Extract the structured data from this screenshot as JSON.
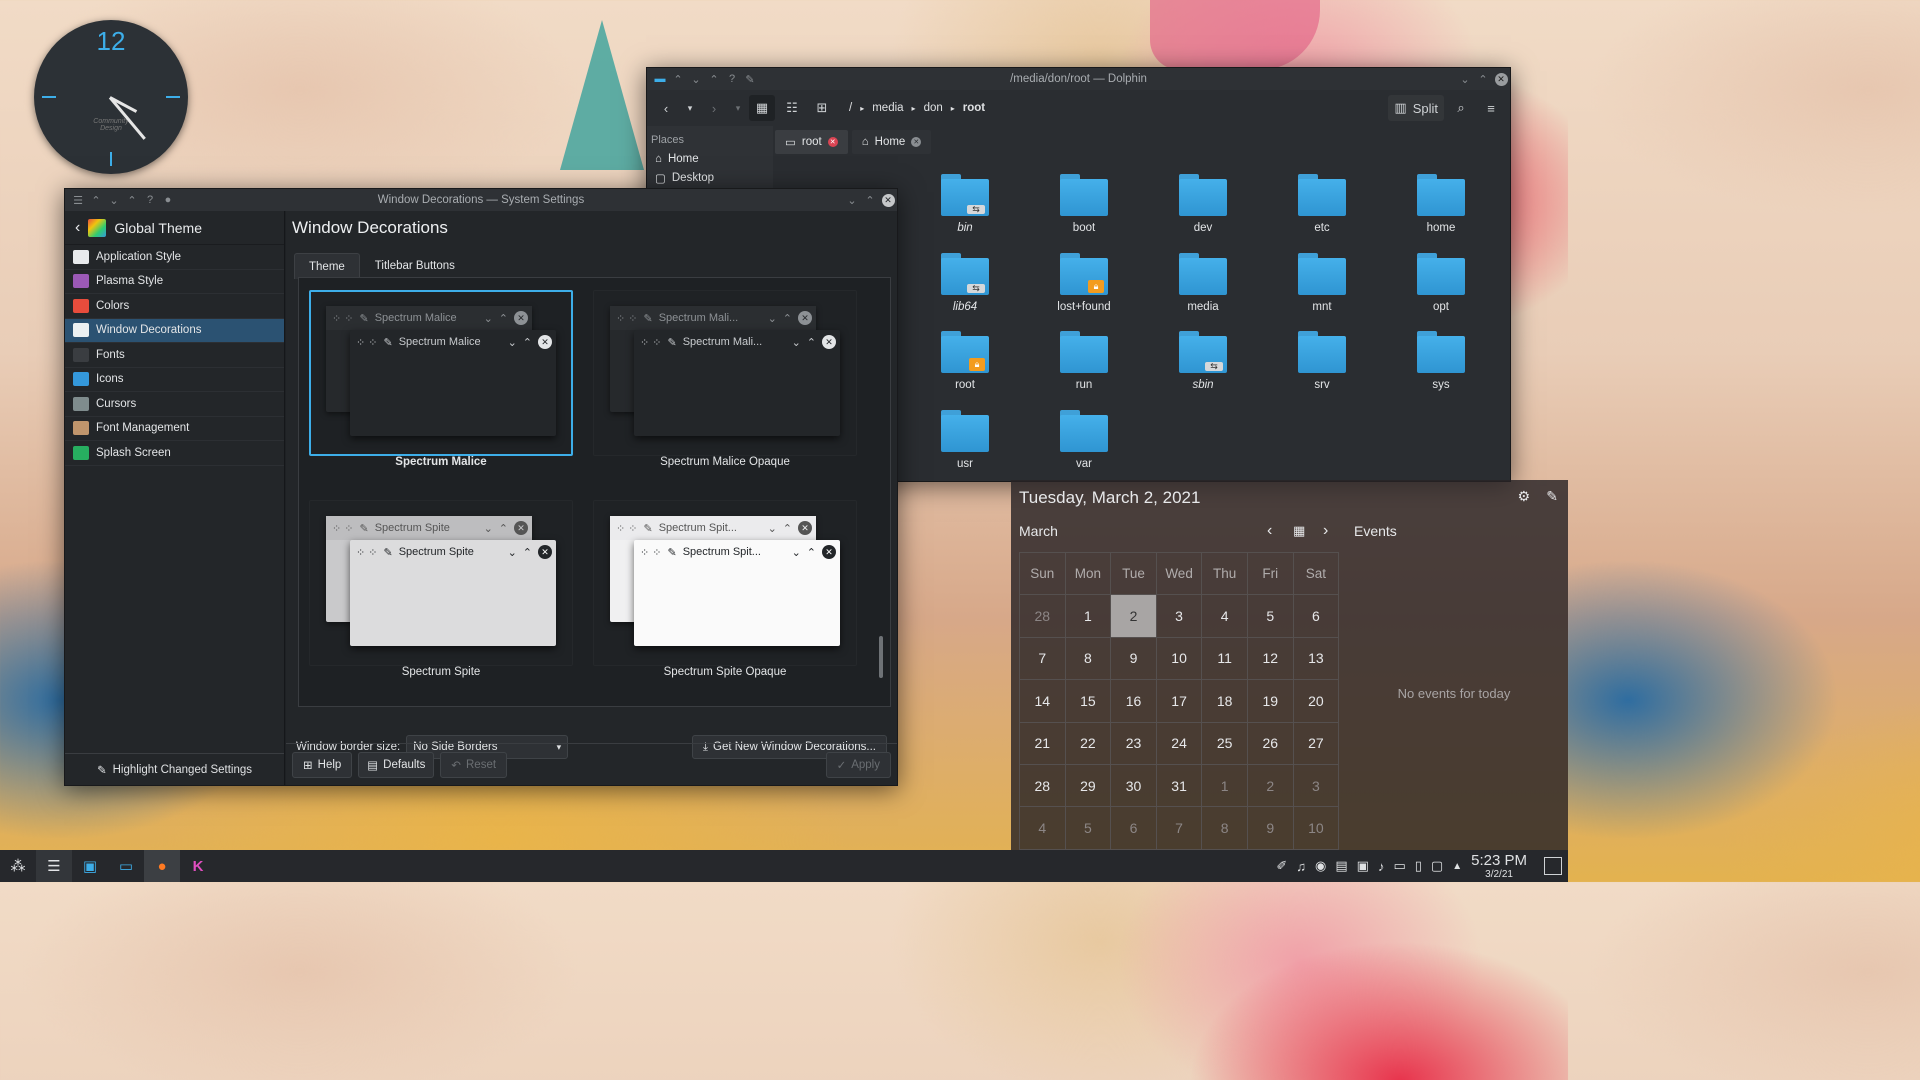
{
  "clock_widget": {
    "hour_label": "12",
    "brand": "Community Design"
  },
  "dolphin": {
    "title": "/media/don/root — Dolphin",
    "breadcrumb": [
      "/",
      "media",
      "don",
      "root"
    ],
    "split_label": "Split",
    "places_header": "Places",
    "places": [
      "Home",
      "Desktop"
    ],
    "tabs": [
      "root",
      "Home"
    ],
    "folders": [
      {
        "name": "bin",
        "badge": "link",
        "italic": true
      },
      {
        "name": "boot",
        "badge": "",
        "italic": false
      },
      {
        "name": "dev",
        "badge": "",
        "italic": false
      },
      {
        "name": "etc",
        "badge": "",
        "italic": false
      },
      {
        "name": "home",
        "badge": "",
        "italic": false
      },
      {
        "name": "lib64",
        "badge": "link",
        "italic": true
      },
      {
        "name": "lost+found",
        "badge": "lock",
        "italic": false
      },
      {
        "name": "media",
        "badge": "",
        "italic": false
      },
      {
        "name": "mnt",
        "badge": "",
        "italic": false
      },
      {
        "name": "opt",
        "badge": "",
        "italic": false
      },
      {
        "name": "root",
        "badge": "lock",
        "italic": false
      },
      {
        "name": "run",
        "badge": "",
        "italic": false
      },
      {
        "name": "sbin",
        "badge": "link",
        "italic": true
      },
      {
        "name": "srv",
        "badge": "",
        "italic": false
      },
      {
        "name": "sys",
        "badge": "",
        "italic": false
      },
      {
        "name": "usr",
        "badge": "",
        "italic": false
      },
      {
        "name": "var",
        "badge": "",
        "italic": false
      }
    ]
  },
  "settings": {
    "title": "Window Decorations — System Settings",
    "back_header": "Global Theme",
    "sidebar": [
      {
        "label": "Application Style",
        "color": "#e8eaec"
      },
      {
        "label": "Plasma Style",
        "color": "#9b59b6"
      },
      {
        "label": "Colors",
        "color": "#e74c3c"
      },
      {
        "label": "Window Decorations",
        "color": "#ecf0f1"
      },
      {
        "label": "Fonts",
        "color": "#3a3d41"
      },
      {
        "label": "Icons",
        "color": "#3498db"
      },
      {
        "label": "Cursors",
        "color": "#7f8c8d"
      },
      {
        "label": "Font Management",
        "color": "#c0956c"
      },
      {
        "label": "Splash Screen",
        "color": "#27ae60"
      }
    ],
    "selected_index": 3,
    "highlight_label": "Highlight Changed Settings",
    "page_title": "Window Decorations",
    "tabs": [
      "Theme",
      "Titlebar Buttons"
    ],
    "themes": [
      {
        "caption": "Spectrum Malice",
        "preview_title": "Spectrum Malice",
        "back_title": "Spectrum Malice",
        "selected": true,
        "light": false
      },
      {
        "caption": "Spectrum Malice Opaque",
        "preview_title": "Spectrum Mali...",
        "back_title": "Spectrum Mali...",
        "selected": false,
        "light": false
      },
      {
        "caption": "Spectrum Spite",
        "preview_title": "Spectrum Spite",
        "back_title": "Spectrum Spite",
        "selected": false,
        "light": true
      },
      {
        "caption": "Spectrum Spite Opaque",
        "preview_title": "Spectrum Spit...",
        "back_title": "Spectrum Spit...",
        "selected": false,
        "light": true
      }
    ],
    "border_label": "Window border size:",
    "border_value": "No Side Borders",
    "get_new_label": "Get New Window Decorations...",
    "help_label": "Help",
    "defaults_label": "Defaults",
    "reset_label": "Reset",
    "apply_label": "Apply"
  },
  "calendar": {
    "date_header": "Tuesday, March 2, 2021",
    "month": "March",
    "events_label": "Events",
    "no_events": "No events for today",
    "weekdays": [
      "Sun",
      "Mon",
      "Tue",
      "Wed",
      "Thu",
      "Fri",
      "Sat"
    ],
    "days": [
      "28",
      "1",
      "2",
      "3",
      "4",
      "5",
      "6",
      "7",
      "8",
      "9",
      "10",
      "11",
      "12",
      "13",
      "14",
      "15",
      "16",
      "17",
      "18",
      "19",
      "20",
      "21",
      "22",
      "23",
      "24",
      "25",
      "26",
      "27",
      "28",
      "29",
      "30",
      "31",
      "1",
      "2",
      "3",
      "4",
      "5",
      "6",
      "7",
      "8",
      "9",
      "10"
    ],
    "today_index": 2
  },
  "taskbar": {
    "time": "5:23 PM",
    "date": "3/2/21"
  }
}
